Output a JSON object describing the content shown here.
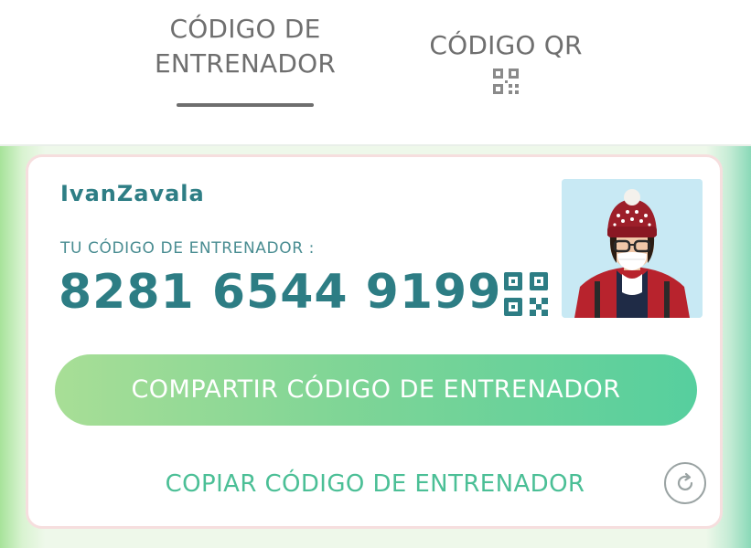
{
  "tabs": [
    {
      "label_line1": "CÓDIGO DE",
      "label_line2": "ENTRENADOR"
    },
    {
      "label": "CÓDIGO QR"
    }
  ],
  "trainer": {
    "username": "IvanZavala",
    "code_label": "TU CÓDIGO DE ENTRENADOR :",
    "code": "8281 6544 9199"
  },
  "buttons": {
    "share": "COMPARTIR CÓDIGO DE ENTRENADOR",
    "copy": "COPIAR CÓDIGO DE ENTRENADOR"
  },
  "icons": {
    "tab_qr": "qr-code-icon",
    "card_qr": "qr-code-icon",
    "refresh": "refresh-icon"
  },
  "colors": {
    "teal_text": "#2d7d84",
    "tab_text": "#6f6f6f",
    "share_gradient_start": "#a8de96",
    "share_gradient_end": "#56cf9e",
    "copy_text": "#4bbf96"
  }
}
